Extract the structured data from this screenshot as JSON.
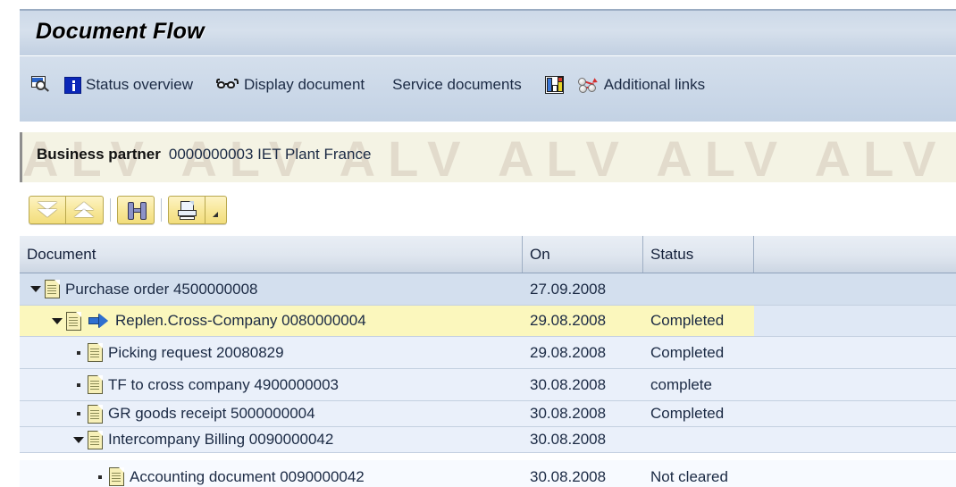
{
  "window": {
    "title": "Document Flow"
  },
  "function_toolbar": {
    "items": [
      {
        "icon": "screen-search-icon",
        "label": ""
      },
      {
        "icon": "info-icon",
        "label": "Status overview"
      },
      {
        "icon": "glasses-icon",
        "label": "Display document"
      },
      {
        "icon": "",
        "label": "Service documents"
      },
      {
        "icon": "bar-chart-icon",
        "label": ""
      },
      {
        "icon": "links-icon",
        "label": "Additional links"
      }
    ],
    "status_overview_label": "Status overview",
    "display_document_label": "Display document",
    "service_documents_label": "Service documents",
    "additional_links_label": "Additional links"
  },
  "business_partner": {
    "label": "Business partner",
    "value": "0000000003 IET Plant France",
    "watermark_text": "ALV ALV ALV ALV ALV ALV ALV ALV ALV"
  },
  "alv_toolbar": {
    "buttons": [
      {
        "name": "expand-all-button",
        "tooltip": "Expand all"
      },
      {
        "name": "collapse-all-button",
        "tooltip": "Collapse all"
      },
      {
        "name": "find-button",
        "tooltip": "Find"
      },
      {
        "name": "print-button",
        "tooltip": "Print"
      },
      {
        "name": "print-menu-button",
        "tooltip": "Print options"
      }
    ]
  },
  "table": {
    "columns": [
      {
        "key": "document",
        "label": "Document"
      },
      {
        "key": "on",
        "label": "On"
      },
      {
        "key": "status",
        "label": "Status"
      },
      {
        "key": "blank",
        "label": ""
      }
    ],
    "rows": [
      {
        "document": "Purchase order 4500000008",
        "on": "27.09.2008",
        "status": "",
        "level": 0,
        "marker": "twisty-down",
        "has_arrow": false,
        "highlighted": false,
        "row_bg": "#d3dfee"
      },
      {
        "document": "Replen.Cross-Company 0080000004",
        "on": "29.08.2008",
        "status": "Completed",
        "level": 1,
        "marker": "twisty-down",
        "has_arrow": true,
        "highlighted": true,
        "row_bg": "#dfe8f5"
      },
      {
        "document": "Picking request 20080829",
        "on": "29.08.2008",
        "status": "Completed",
        "level": 2,
        "marker": "bullet",
        "has_arrow": false,
        "highlighted": false,
        "row_bg": "#eaf0fa"
      },
      {
        "document": "TF to cross company 4900000003",
        "on": "30.08.2008",
        "status": "complete",
        "level": 2,
        "marker": "bullet",
        "has_arrow": false,
        "highlighted": false,
        "row_bg": "#eaf0fa"
      },
      {
        "document": "GR goods receipt 5000000004",
        "on": "30.08.2008",
        "status": "Completed",
        "level": 2,
        "marker": "bullet",
        "has_arrow": false,
        "highlighted": false,
        "row_bg": "#eaf0fa"
      },
      {
        "document": "Intercompany Billing 0090000042",
        "on": "30.08.2008",
        "status": "",
        "level": 2,
        "marker": "twisty-down",
        "has_arrow": false,
        "highlighted": false,
        "row_bg": "#eaf0fa"
      },
      {
        "document": "Accounting document 0090000042",
        "on": "30.08.2008",
        "status": "Not cleared",
        "level": 3,
        "marker": "bullet",
        "has_arrow": false,
        "highlighted": false,
        "row_bg": "#f7faff"
      }
    ]
  },
  "colors": {
    "title_bar": "#cdd9e8",
    "toolbar": "#cbd8e8",
    "business_partner_bg": "#f4f3e4",
    "alv_button": "#f8e89b",
    "highlight": "#fbf7bd",
    "header_row": "#dfe6ef",
    "grid_line": "#c4d0e0",
    "text": "#1b2a44"
  }
}
